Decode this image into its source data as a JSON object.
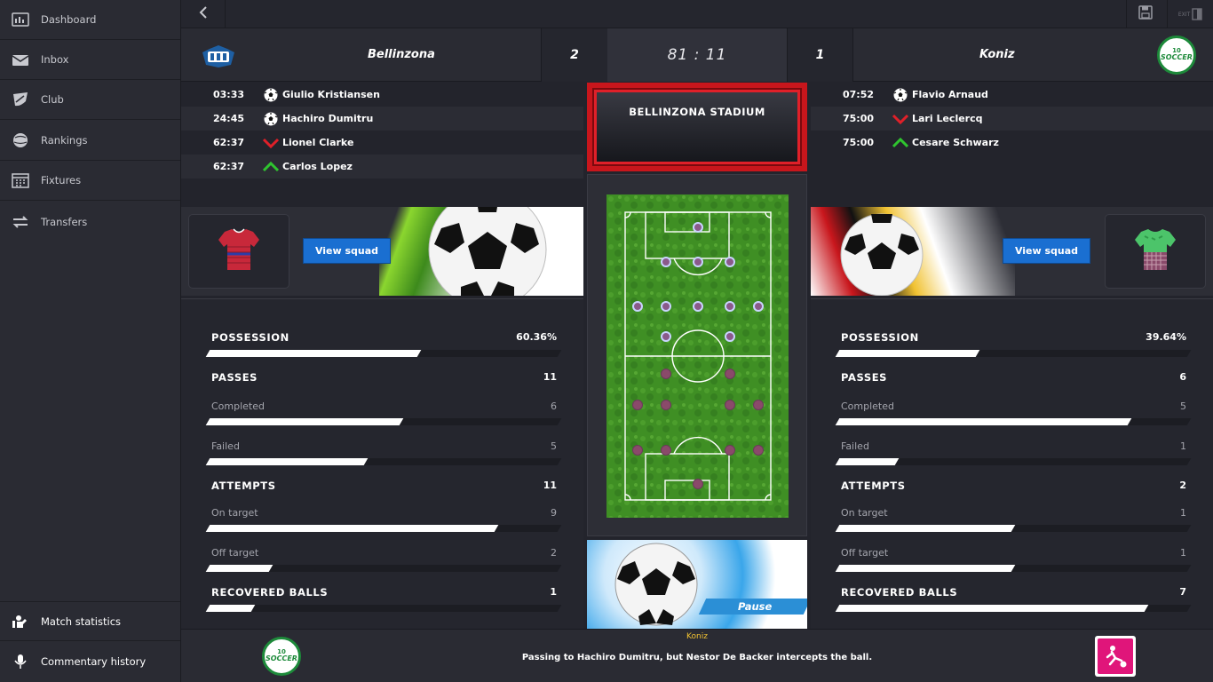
{
  "sidebar": {
    "items": [
      {
        "label": "Dashboard",
        "icon": "dashboard-icon"
      },
      {
        "label": "Inbox",
        "icon": "inbox-icon"
      },
      {
        "label": "Club",
        "icon": "club-icon"
      },
      {
        "label": "Rankings",
        "icon": "rankings-icon"
      },
      {
        "label": "Fixtures",
        "icon": "calendar-icon"
      },
      {
        "label": "Transfers",
        "icon": "transfers-icon"
      }
    ],
    "bottom_items": [
      {
        "label": "Match statistics",
        "icon": "match-statistics-icon"
      },
      {
        "label": "Commentary history",
        "icon": "microphone-icon"
      }
    ]
  },
  "topbar": {
    "back_icon": "chevron-left-icon",
    "save_icon": "save-icon",
    "exit_icon": "exit-icon",
    "exit_label": "EXIT"
  },
  "match": {
    "home_team": "Bellinzona",
    "away_team": "Koniz",
    "home_score": "2",
    "away_score": "1",
    "clock": "81 : 11",
    "stadium": "BELLINZONA STADIUM",
    "away_logo_text": "SOCCER",
    "away_logo_number": "10"
  },
  "home_events": [
    {
      "time": "03:33",
      "type": "goal",
      "player": "Giulio Kristiansen"
    },
    {
      "time": "24:45",
      "type": "goal",
      "player": "Hachiro Dumitru"
    },
    {
      "time": "62:37",
      "type": "sub-out",
      "player": "Lionel Clarke"
    },
    {
      "time": "62:37",
      "type": "sub-in",
      "player": "Carlos Lopez"
    }
  ],
  "away_events": [
    {
      "time": "07:52",
      "type": "goal",
      "player": "Flavio Arnaud"
    },
    {
      "time": "75:00",
      "type": "sub-out",
      "player": "Lari Leclercq"
    },
    {
      "time": "75:00",
      "type": "sub-in",
      "player": "Cesare Schwarz"
    }
  ],
  "squad": {
    "home_button": "View squad",
    "away_button": "View squad"
  },
  "pause_label": "Pause",
  "home_stats": {
    "possession_label": "POSSESSION",
    "possession": "60.36%",
    "possession_frac": 0.6,
    "passes_label": "PASSES",
    "passes": "11",
    "completed_label": "Completed",
    "completed": "6",
    "completed_frac": 0.55,
    "failed_label": "Failed",
    "failed": "5",
    "failed_frac": 0.45,
    "attempts_label": "ATTEMPTS",
    "attempts": "11",
    "on_target_label": "On target",
    "on_target": "9",
    "on_target_frac": 0.82,
    "off_target_label": "Off target",
    "off_target": "2",
    "off_target_frac": 0.18,
    "recovered_label": "RECOVERED BALLS",
    "recovered": "1",
    "recovered_frac": 0.13
  },
  "away_stats": {
    "possession_label": "POSSESSION",
    "possession": "39.64%",
    "possession_frac": 0.4,
    "passes_label": "PASSES",
    "passes": "6",
    "completed_label": "Completed",
    "completed": "5",
    "completed_frac": 0.83,
    "failed_label": "Failed",
    "failed": "1",
    "failed_frac": 0.17,
    "attempts_label": "ATTEMPTS",
    "attempts": "2",
    "on_target_label": "On target",
    "on_target": "1",
    "on_target_frac": 0.5,
    "off_target_label": "Off target",
    "off_target": "1",
    "off_target_frac": 0.5,
    "recovered_label": "RECOVERED BALLS",
    "recovered": "7",
    "recovered_frac": 0.88
  },
  "commentary": {
    "team": "Koniz",
    "text": "Passing to Hachiro Dumitru, but Nestor De Backer intercepts the ball.",
    "logo_text": "SOCCER",
    "logo_number": "10",
    "event_icon": "tackle-icon"
  },
  "colors": {
    "accent_blue": "#1a6fd1",
    "stadium_red": "#c8161c",
    "goal_icon": "#ffffff",
    "sub_out": "#e02029",
    "sub_in": "#2fc42f",
    "comm_team": "#f1c232",
    "tackle_icon_bg": "#e0157a"
  }
}
